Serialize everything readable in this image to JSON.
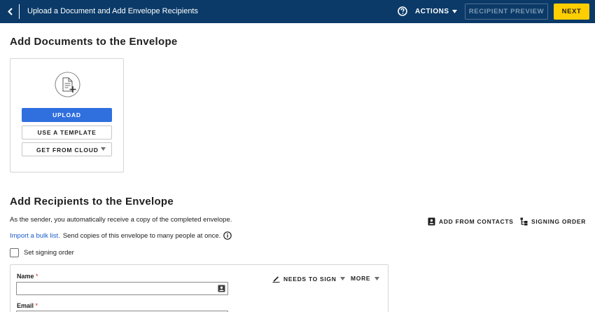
{
  "header": {
    "title": "Upload a Document and Add Envelope Recipients",
    "actions_label": "ACTIONS",
    "preview_label": "RECIPIENT PREVIEW",
    "next_label": "NEXT",
    "colors": {
      "bar": "#0b3a68",
      "next": "#ffce00"
    }
  },
  "documents": {
    "heading": "Add Documents to the Envelope",
    "upload_label": "UPLOAD",
    "template_label": "USE A TEMPLATE",
    "cloud_label": "GET FROM CLOUD",
    "colors": {
      "upload": "#2f6fde"
    }
  },
  "recipients": {
    "heading": "Add Recipients to the Envelope",
    "sender_note": "As the sender, you automatically receive a copy of the completed envelope.",
    "bulk_link": "Import a bulk list.",
    "bulk_text": "Send copies of this envelope to many people at once.",
    "add_contacts_label": "ADD FROM CONTACTS",
    "signing_order_label": "SIGNING ORDER",
    "set_signing_order_label": "Set signing order",
    "card": {
      "name_label": "Name",
      "email_label": "Email",
      "required_mark": "*",
      "name_value": "",
      "email_value": "",
      "role_label": "NEEDS TO SIGN",
      "more_label": "MORE"
    }
  },
  "icons": {
    "back": "chevron-left-icon",
    "help": "question-circle-icon",
    "document": "document-add-icon",
    "info": "info-circle-icon",
    "contacts": "contact-book-icon",
    "signing_order": "signing-order-icon",
    "pen": "pen-icon",
    "caret": "caret-down-icon"
  }
}
